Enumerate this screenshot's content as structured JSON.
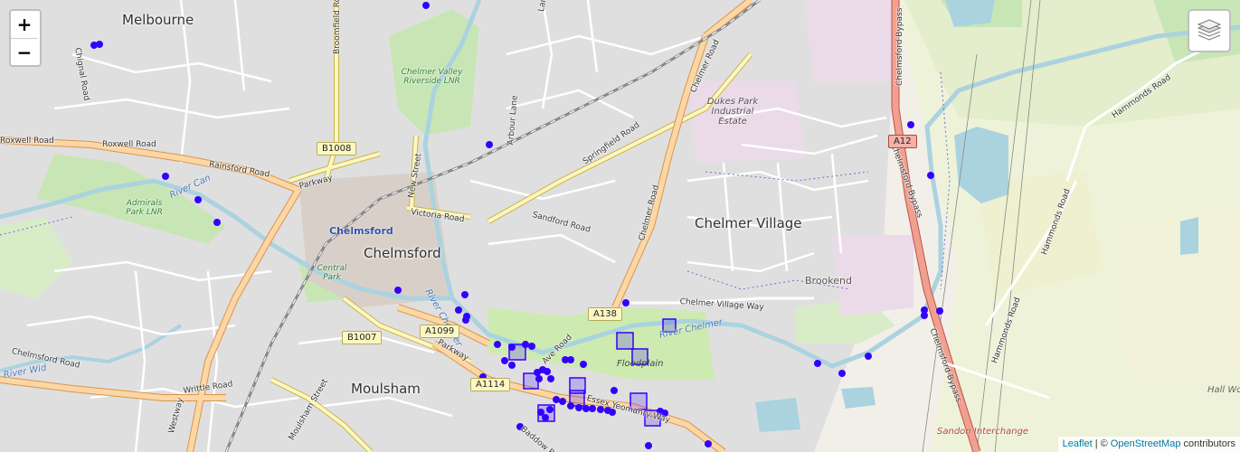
{
  "map": {
    "zoom_in_label": "+",
    "zoom_out_label": "−",
    "layers_icon": "layers-icon",
    "attribution": {
      "leaflet": "Leaflet",
      "separator": "|",
      "copyright": "©",
      "osm": "OpenStreetMap",
      "contributors": "contributors"
    },
    "marker_color": "#3300ff",
    "places": {
      "melbourne": "Melbourne",
      "chelmsford": "Chelmsford",
      "chelmsford_station": "Chelmsford",
      "chelmer_village": "Chelmer Village",
      "moulsham": "Moulsham",
      "brookend": "Brookend",
      "dukes_park": "Dukes Park Industrial Estate",
      "chelmer_valley": "Chelmer Valley Riverside LNR",
      "admirals_park": "Admirals Park LNR",
      "central_park": "Central Park",
      "sandon_interchange": "Sandon Interchange",
      "hall_wood": "Hall Wo",
      "flood_plain": "Floodplain"
    },
    "roads": {
      "roxwell": "Roxwell Road",
      "rainsford": "Rainsford Road",
      "parkway": "Parkway",
      "parkway2": "Parkway",
      "new_street": "New Street",
      "victoria": "Victoria Road",
      "sandford": "Sandford Road",
      "springfield": "Springfield Road",
      "chelmer_road": "Chelmer Road",
      "chelmer_road2": "Chelmer Road",
      "chelmer_village_way": "Chelmer Village Way",
      "broomfield": "Broomfield Road",
      "arbour": "Arbour Lane",
      "chignal": "Chignal Road",
      "chelmsford_rd": "Chelmsford Road",
      "writtle": "Writtle Road",
      "westway": "Westway",
      "moulsham_st": "Moulsham Street",
      "essex_yeomanry": "Essex Yeomanry Way",
      "baddow": "Baddow Road",
      "chelmsford_bypass": "Chelmsford Bypass",
      "chelmsford_bypass2": "Chelmsford Bypass",
      "hammonds": "Hammonds Road",
      "hammonds2": "Hammonds Road",
      "hammonds3": "Hammonds Road",
      "cedar": "Ave Road",
      "lane_top": "Lane"
    },
    "water": {
      "river_can": "River Can",
      "river_chelmer": "River Chelmer",
      "river_chelmer2": "River Chelmer",
      "river_wid": "River Wid"
    },
    "shields": {
      "b1008": "B1008",
      "b1007": "B1007",
      "a1099": "A1099",
      "a1114": "A1114",
      "a138": "A138",
      "a12": "A12"
    }
  }
}
